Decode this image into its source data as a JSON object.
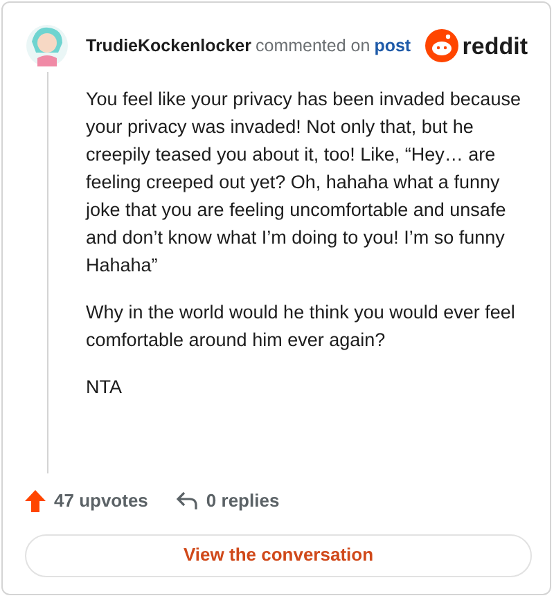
{
  "header": {
    "username": "TrudieKockenlocker",
    "action": "commented on",
    "link": "post",
    "brand": "reddit"
  },
  "comment": {
    "paragraphs": [
      "You feel like your privacy has been invaded because your privacy was invaded! Not only that, but he creepily teased you about it, too! Like, “Hey… are feeling creeped out yet? Oh, hahaha what a funny joke that you are feeling uncomfortable and unsafe and don’t know what I’m doing to you! I’m so funny Hahaha”",
      "Why in the world would he think you would ever feel comfortable around him ever again?",
      "NTA"
    ]
  },
  "footer": {
    "upvotes": "47 upvotes",
    "replies": "0 replies"
  },
  "button": "View the conversation"
}
